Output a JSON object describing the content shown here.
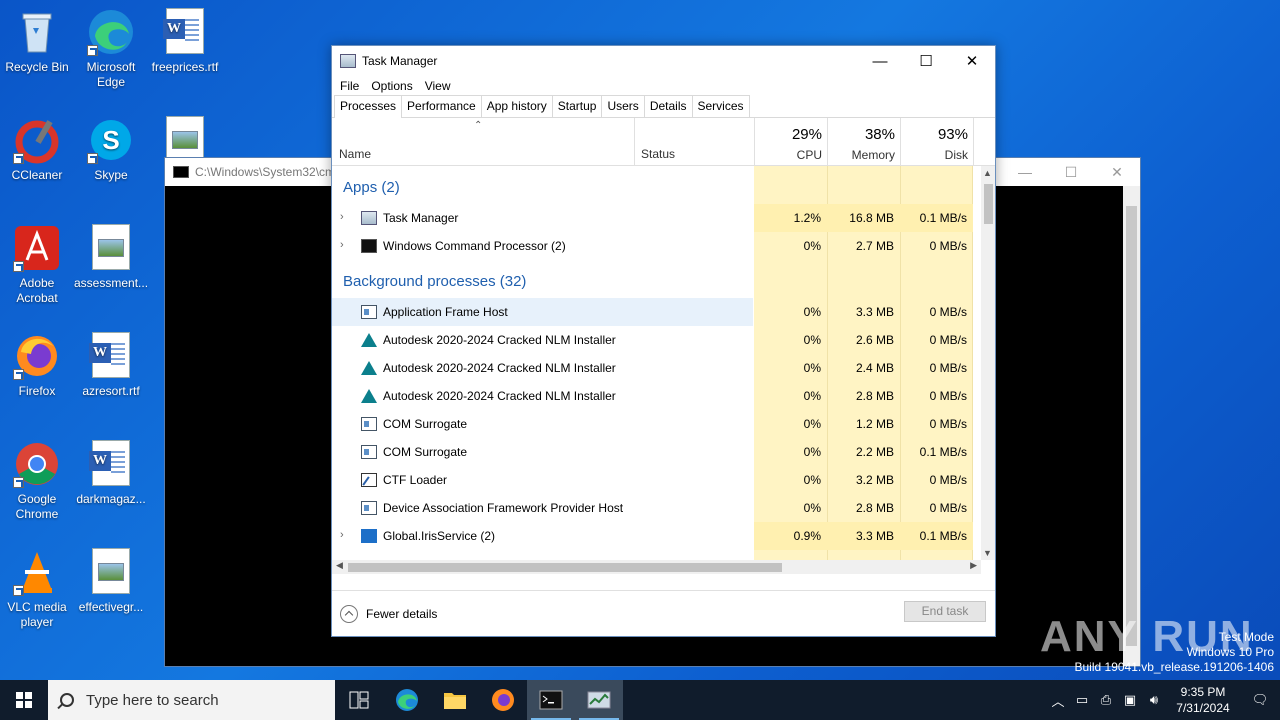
{
  "desktop": {
    "icons": [
      {
        "label": "Recycle Bin"
      },
      {
        "label": "Microsoft Edge"
      },
      {
        "label": "freeprices.rtf"
      },
      {
        "label": "CCleaner"
      },
      {
        "label": "Skype"
      },
      {
        "label": "Adobe Acrobat"
      },
      {
        "label": "assessment..."
      },
      {
        "label": "Firefox"
      },
      {
        "label": "azresort.rtf"
      },
      {
        "label": "Google Chrome"
      },
      {
        "label": "darkmagaz..."
      },
      {
        "label": "VLC media player"
      },
      {
        "label": "effectivegr..."
      }
    ]
  },
  "console": {
    "title": "C:\\Windows\\System32\\cm"
  },
  "taskmanager": {
    "title": "Task Manager",
    "menu": [
      "File",
      "Options",
      "View"
    ],
    "tabs": [
      "Processes",
      "Performance",
      "App history",
      "Startup",
      "Users",
      "Details",
      "Services"
    ],
    "active_tab": "Processes",
    "columns": {
      "name": "Name",
      "status": "Status",
      "cpu": {
        "pct": "29%",
        "label": "CPU"
      },
      "memory": {
        "pct": "38%",
        "label": "Memory"
      },
      "disk": {
        "pct": "93%",
        "label": "Disk"
      }
    },
    "groups": {
      "apps": "Apps (2)",
      "background": "Background processes (32)"
    },
    "apps": [
      {
        "name": "Task Manager",
        "cpu": "1.2%",
        "memory": "16.8 MB",
        "disk": "0.1 MB/s",
        "icon": "task-manager-icon"
      },
      {
        "name": "Windows Command Processor (2)",
        "cpu": "0%",
        "memory": "2.7 MB",
        "disk": "0 MB/s",
        "icon": "console-icon"
      }
    ],
    "background": [
      {
        "name": "Application Frame Host",
        "cpu": "0%",
        "memory": "3.3 MB",
        "disk": "0 MB/s",
        "icon": "frame-icon"
      },
      {
        "name": "Autodesk 2020-2024 Cracked NLM Installer",
        "cpu": "0%",
        "memory": "2.6 MB",
        "disk": "0 MB/s",
        "icon": "autodesk-icon"
      },
      {
        "name": "Autodesk 2020-2024 Cracked NLM Installer",
        "cpu": "0%",
        "memory": "2.4 MB",
        "disk": "0 MB/s",
        "icon": "autodesk-icon"
      },
      {
        "name": "Autodesk 2020-2024 Cracked NLM Installer",
        "cpu": "0%",
        "memory": "2.8 MB",
        "disk": "0 MB/s",
        "icon": "autodesk-icon"
      },
      {
        "name": "COM Surrogate",
        "cpu": "0%",
        "memory": "1.2 MB",
        "disk": "0 MB/s",
        "icon": "frame-icon"
      },
      {
        "name": "COM Surrogate",
        "cpu": "0%",
        "memory": "2.2 MB",
        "disk": "0.1 MB/s",
        "icon": "frame-icon"
      },
      {
        "name": "CTF Loader",
        "cpu": "0%",
        "memory": "3.2 MB",
        "disk": "0 MB/s",
        "icon": "ctf-icon"
      },
      {
        "name": "Device Association Framework Provider Host",
        "cpu": "0%",
        "memory": "2.8 MB",
        "disk": "0 MB/s",
        "icon": "frame-icon"
      },
      {
        "name": "Global.IrisService (2)",
        "cpu": "0.9%",
        "memory": "3.3 MB",
        "disk": "0.1 MB/s",
        "icon": "iris-icon"
      }
    ],
    "footer": {
      "fewer_details": "Fewer details",
      "end_task": "End task"
    }
  },
  "watermark": {
    "text": "ANY RUN"
  },
  "build_info": {
    "line1": "Test Mode",
    "line2": "Windows 10 Pro",
    "line3": "Build 19041.vb_release.191206-1406"
  },
  "taskbar": {
    "search_placeholder": "Type here to search",
    "clock_time": "9:35 PM",
    "clock_date": "7/31/2024"
  },
  "colors": {
    "accent": "#1f5fae",
    "cpu_heat": "#fff4c4",
    "cpu_heat_strong": "#fff0b0"
  }
}
